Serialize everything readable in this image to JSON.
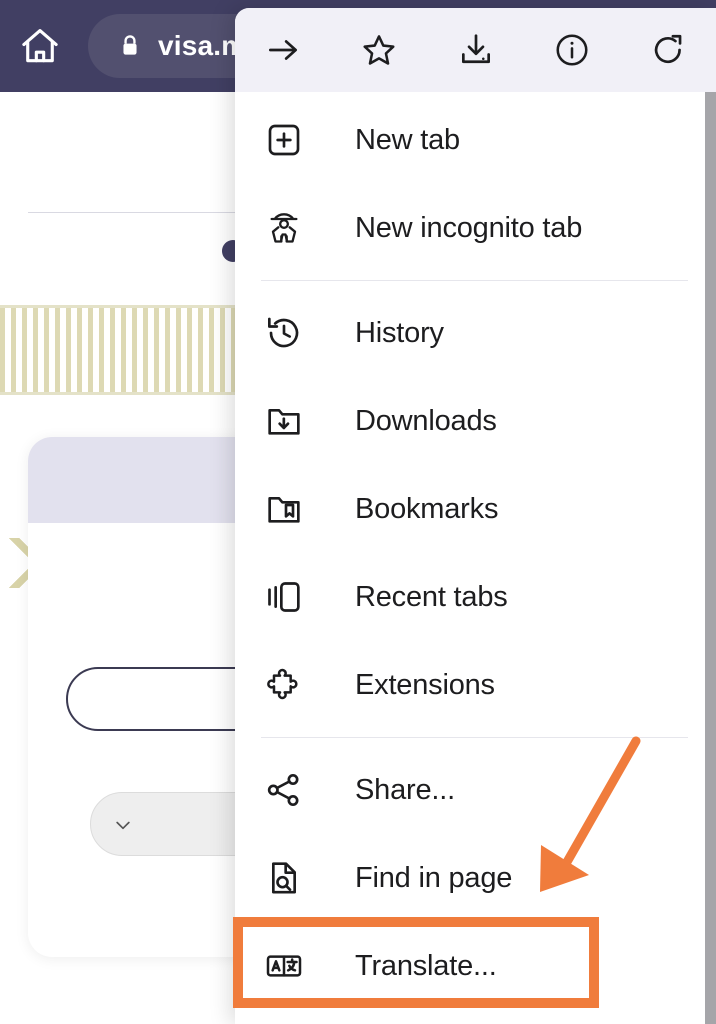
{
  "browser": {
    "home_icon": "home-icon",
    "lock_icon": "lock-icon",
    "url_text": "visa.m"
  },
  "menu": {
    "toolbar": [
      {
        "name": "forward-icon",
        "label": "Forward"
      },
      {
        "name": "bookmark-star-icon",
        "label": "Bookmark"
      },
      {
        "name": "download-icon",
        "label": "Download"
      },
      {
        "name": "page-info-icon",
        "label": "Page info"
      },
      {
        "name": "reload-icon",
        "label": "Reload"
      }
    ],
    "items": [
      {
        "label": "New tab",
        "icon": "new-tab-icon"
      },
      {
        "label": "New incognito tab",
        "icon": "incognito-icon"
      },
      {
        "divider": true
      },
      {
        "label": "History",
        "icon": "history-icon"
      },
      {
        "label": "Downloads",
        "icon": "downloads-folder-icon"
      },
      {
        "label": "Bookmarks",
        "icon": "bookmarks-folder-icon"
      },
      {
        "label": "Recent tabs",
        "icon": "recent-tabs-icon"
      },
      {
        "label": "Extensions",
        "icon": "puzzle-piece-icon"
      },
      {
        "divider": true
      },
      {
        "label": "Share...",
        "icon": "share-icon"
      },
      {
        "label": "Find in page",
        "icon": "find-in-page-icon"
      },
      {
        "label": "Translate...",
        "icon": "translate-icon",
        "highlighted": true
      }
    ]
  },
  "annotations": {
    "highlight_color": "#F07C3C",
    "arrow_color": "#F07C3C",
    "highlighted_item": "Translate..."
  },
  "colors": {
    "chrome_background": "#413F63",
    "omnibox_background": "#52506F",
    "menu_background": "#FFFFFF",
    "menu_header_background": "#F1F0F7",
    "menu_text": "#1D1D1F",
    "scrollbar": "#A5A5A9",
    "card_header": "#E2E1EE",
    "pattern_band": "#DDD9B4"
  }
}
